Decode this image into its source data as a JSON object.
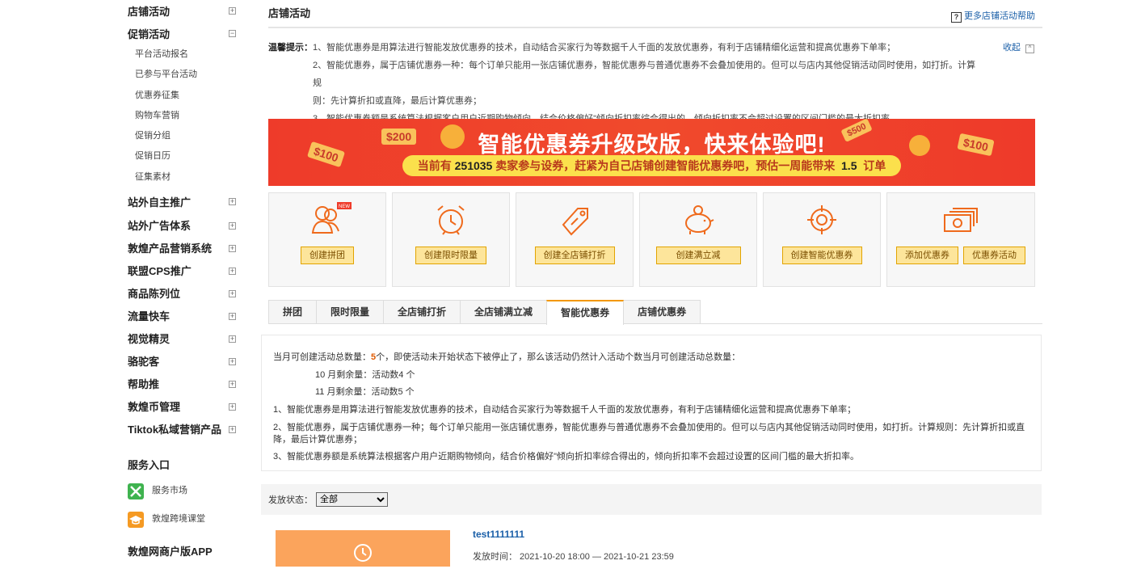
{
  "sidebar": {
    "sections": [
      {
        "label": "店铺活动",
        "toggle": "+"
      },
      {
        "label": "促销活动",
        "toggle": "−"
      }
    ],
    "promo_items": [
      "平台活动报名",
      "已参与平台活动",
      "优惠券征集",
      "购物车营销",
      "促销分组",
      "促销日历",
      "征集素材"
    ],
    "sections2": [
      {
        "label": "站外自主推广",
        "toggle": "+"
      },
      {
        "label": "站外广告体系",
        "toggle": "+"
      },
      {
        "label": "敦煌产品营销系统",
        "toggle": "+"
      },
      {
        "label": "联盟CPS推广",
        "toggle": "+"
      },
      {
        "label": "商品陈列位",
        "toggle": "+"
      },
      {
        "label": "流量快车",
        "toggle": "+"
      },
      {
        "label": "视觉精灵",
        "toggle": "+"
      },
      {
        "label": "骆驼客",
        "toggle": "+"
      },
      {
        "label": "帮助推",
        "toggle": "+"
      },
      {
        "label": "敦煌币管理",
        "toggle": "+"
      },
      {
        "label": "Tiktok私域营销产品",
        "toggle": "+"
      }
    ],
    "services_title": "服务入口",
    "services": [
      {
        "label": "服务市场",
        "icon": "tools-icon",
        "color": "#3fb34f"
      },
      {
        "label": "敦煌跨境课堂",
        "icon": "graduation-cap-icon",
        "color": "#f59a23"
      }
    ],
    "app_title": "敦煌网商户版APP"
  },
  "page": {
    "title": "店铺活动",
    "help_label": "更多店铺活动帮助",
    "tips_label": "温馨提示：",
    "tips_collapse": "收起",
    "tips": [
      "1、智能优惠券是用算法进行智能发放优惠券的技术，自动结合买家行为等数据千人千面的发放优惠券，有利于店铺精细化运营和提高优惠券下单率；",
      "2、智能优惠券，属于店铺优惠券一种：每个订单只能用一张店铺优惠券，智能优惠券与普通优惠券不会叠加使用的。但可以与店内其他促销活动同时使用，如打折。计算规",
      "则：先计算折扣或直降，最后计算优惠券；",
      "3、智能优惠券额是系统算法根据客户用户近期购物倾向，结合价格偏好\"倾向折扣率综合得出的，倾向折扣率不会超过设置的区间门槛的最大折扣率。"
    ]
  },
  "banner": {
    "headline": "智能优惠券升级改版，快来体验吧!",
    "pill_pre": "当前有",
    "pill_count": "251035",
    "pill_mid": "卖家参与设券，赶紧为自己店铺创建智能优惠券吧，预估一周能带来",
    "pill_num": "1.5",
    "pill_post": "订单",
    "bills": [
      "$200",
      "$100",
      "$500",
      "$100"
    ]
  },
  "cards": [
    {
      "icon": "group-buy-icon",
      "buttons": [
        "创建拼团"
      ],
      "badge": "NEW"
    },
    {
      "icon": "alarm-clock-icon",
      "buttons": [
        "创建限时限量"
      ]
    },
    {
      "icon": "price-tag-icon",
      "buttons": [
        "创建全店铺打折"
      ]
    },
    {
      "icon": "piggy-bank-icon",
      "buttons": [
        "创建满立减"
      ]
    },
    {
      "icon": "target-icon",
      "buttons": [
        "创建智能优惠券"
      ]
    },
    {
      "icon": "cash-icon",
      "buttons": [
        "添加优惠券",
        "优惠券活动"
      ]
    }
  ],
  "tabs": [
    "拼团",
    "限时限量",
    "全店铺打折",
    "全店铺满立减",
    "智能优惠券",
    "店铺优惠券"
  ],
  "active_tab_index": 4,
  "info": {
    "line1_pre": "当月可创建活动总数量：",
    "line1_count": "5",
    "line1_post": "个，即使活动未开始状态下被停止了，那么该活动仍然计入活动个数当月可创建活动总数量：",
    "oct": "10 月剩余量：活动数4 个",
    "nov": "11 月剩余量：活动数5 个",
    "p1": "1、智能优惠券是用算法进行智能发放优惠券的技术，自动结合买家行为等数据千人千面的发放优惠券，有利于店铺精细化运营和提高优惠券下单率；",
    "p2a": "2、智能优惠券，属于店铺优惠券一种；每个订单只能用一张店铺优惠券，智能优惠券与普通优惠券不会叠加使用的。但可以与店内其他促销活动同时使用，如打折。计算规则：先计算折扣或直",
    "p2b": "降，最后计算优惠券；",
    "p3": "3、智能优惠券额是系统算法根据客户用户近期购物倾向，结合价格偏好\"倾向折扣率综合得出的，倾向折扣率不会超过设置的区间门槛的最大折扣率。"
  },
  "filter": {
    "label": "发放状态：",
    "selected": "全部"
  },
  "list_item": {
    "name": "test1111111",
    "time": "发放时间： 2021-10-20 18:00 — 2021-10-21 23:59"
  },
  "colors": {
    "accent": "#f39800",
    "link": "#1a5fa8",
    "banner": "#ee3b2a",
    "button_bg": "#fde59b",
    "icon": "#ef6a1c"
  }
}
